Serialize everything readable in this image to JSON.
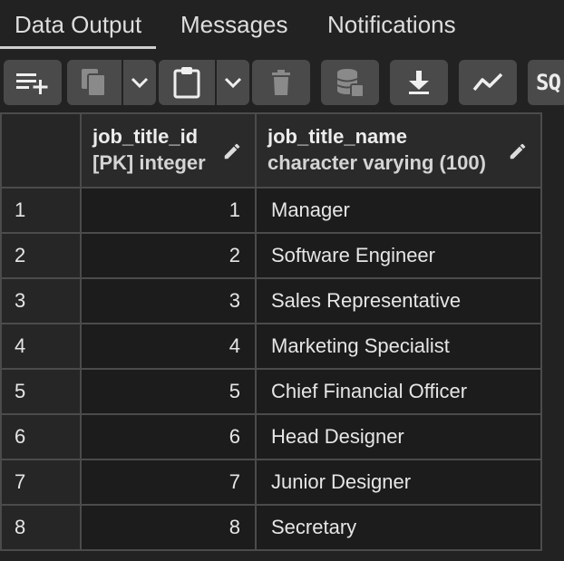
{
  "tabs": [
    {
      "label": "Data Output",
      "active": true
    },
    {
      "label": "Messages",
      "active": false
    },
    {
      "label": "Notifications",
      "active": false
    }
  ],
  "toolbar": {
    "sql_label": "SQ"
  },
  "columns": [
    {
      "name": "",
      "type": ""
    },
    {
      "name": "job_title_id",
      "type": "[PK] integer"
    },
    {
      "name": "job_title_name",
      "type": "character varying (100)"
    }
  ],
  "rows": [
    {
      "n": "1",
      "id": "1",
      "name": "Manager"
    },
    {
      "n": "2",
      "id": "2",
      "name": "Software Engineer"
    },
    {
      "n": "3",
      "id": "3",
      "name": "Sales Representative"
    },
    {
      "n": "4",
      "id": "4",
      "name": "Marketing Specialist"
    },
    {
      "n": "5",
      "id": "5",
      "name": "Chief Financial Officer"
    },
    {
      "n": "6",
      "id": "6",
      "name": "Head Designer"
    },
    {
      "n": "7",
      "id": "7",
      "name": "Junior Designer"
    },
    {
      "n": "8",
      "id": "8",
      "name": "Secretary"
    }
  ],
  "colors": {
    "background": "#222222",
    "button": "#4a4a4a",
    "grid_line": "#4b4b4b",
    "text": "#e6e6e6"
  }
}
